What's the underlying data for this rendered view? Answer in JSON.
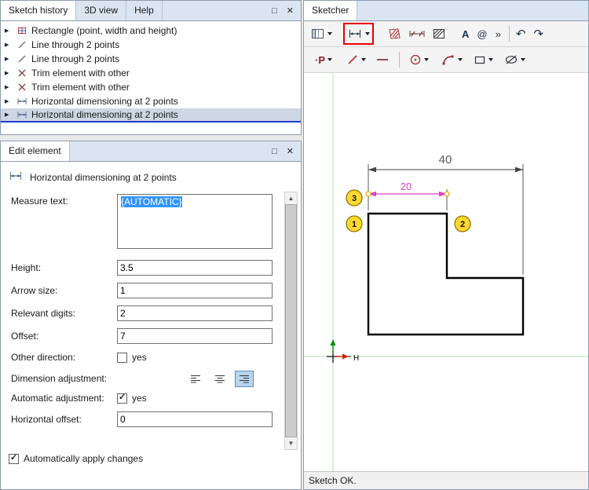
{
  "window": {
    "maximize_glyph": "□",
    "close_glyph": "✕",
    "scroll_up_glyph": "▲",
    "scroll_down_glyph": "▼"
  },
  "colors": {
    "selection_blue": "#3094ff",
    "highlight_red": "#e80000",
    "dimension_magenta": "#e03cc8",
    "marker_yellow": "#ffd92e",
    "axis_green": "#b4dcb4",
    "x_axis_red": "#cc2200",
    "y_axis_green": "#009000",
    "selected_item_underline": "#1f3bd4"
  },
  "sketch_history": {
    "expand_glyph": "▶",
    "tabs": [
      {
        "label": "Sketch history"
      },
      {
        "label": "3D view"
      },
      {
        "label": "Help"
      }
    ],
    "items": [
      {
        "label": "Rectangle (point, width and height)"
      },
      {
        "label": "Line through 2 points"
      },
      {
        "label": "Line through 2 points"
      },
      {
        "label": "Trim element with other"
      },
      {
        "label": "Trim element with other"
      },
      {
        "label": "Horizontal dimensioning at 2 points"
      },
      {
        "label": "Horizontal dimensioning at 2 points",
        "selected": true
      }
    ]
  },
  "edit_element": {
    "tab_label": "Edit element",
    "header_title": "Horizontal dimensioning at 2 points",
    "measure_text": {
      "label": "Measure text:",
      "value": "{AUTOMATIC}"
    },
    "height": {
      "label": "Height:",
      "value": "3.5"
    },
    "arrow_size": {
      "label": "Arrow size:",
      "value": "1"
    },
    "relevant_digits": {
      "label": "Relevant digits:",
      "value": "2"
    },
    "offset": {
      "label": "Offset:",
      "value": "7"
    },
    "other_direction": {
      "label": "Other direction:",
      "option_label": "yes",
      "checked": false
    },
    "dimension_adjustment": {
      "label": "Dimension adjustment:",
      "selected_option": "right"
    },
    "automatic_adjustment": {
      "label": "Automatic adjustment:",
      "option_label": "yes",
      "checked": true
    },
    "horizontal_offset": {
      "label": "Horizontal offset:",
      "value": "0"
    },
    "apply_changes": {
      "label": "Automatically apply changes",
      "checked": true
    }
  },
  "sketcher": {
    "tab_label": "Sketcher",
    "toolbar_glyphs": {
      "text_tool": "A",
      "at_tool": "@",
      "overflow": "»",
      "undo": "↶",
      "redo": "↷",
      "point_tool": "·P"
    },
    "status_text": "Sketch OK.",
    "drawing": {
      "overall_width_dim": "40",
      "partial_width_dim": "20",
      "marker_top_left": "3",
      "marker_bottom_left": "1",
      "marker_bottom_right": "2",
      "origin_label": "H"
    }
  }
}
